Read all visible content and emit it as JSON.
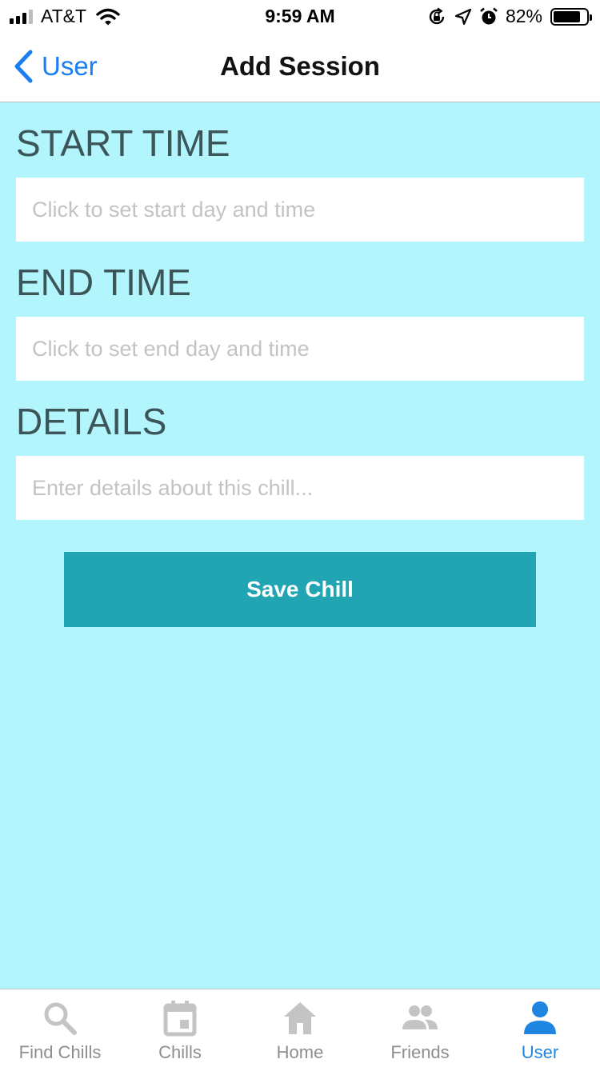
{
  "status_bar": {
    "carrier": "AT&T",
    "time": "9:59 AM",
    "battery_percent": "82%",
    "battery_level": 0.82,
    "signal_bars": 3
  },
  "nav": {
    "back_label": "User",
    "title": "Add Session"
  },
  "form": {
    "start_label": "START TIME",
    "start_placeholder": "Click to set start day and time",
    "end_label": "END TIME",
    "end_placeholder": "Click to set end day and time",
    "details_label": "DETAILS",
    "details_placeholder": "Enter details about this chill...",
    "save_label": "Save Chill"
  },
  "tabs": [
    {
      "label": "Find Chills",
      "icon": "search-icon",
      "active": false
    },
    {
      "label": "Chills",
      "icon": "calendar-icon",
      "active": false
    },
    {
      "label": "Home",
      "icon": "home-icon",
      "active": false
    },
    {
      "label": "Friends",
      "icon": "people-icon",
      "active": false
    },
    {
      "label": "User",
      "icon": "person-icon",
      "active": true
    }
  ],
  "colors": {
    "background": "#b2f5fd",
    "accent": "#1a7ef2",
    "button": "#21a5b3",
    "label": "#3c5558",
    "tab_inactive": "#c4c4c4",
    "tab_active": "#1e86e0"
  }
}
